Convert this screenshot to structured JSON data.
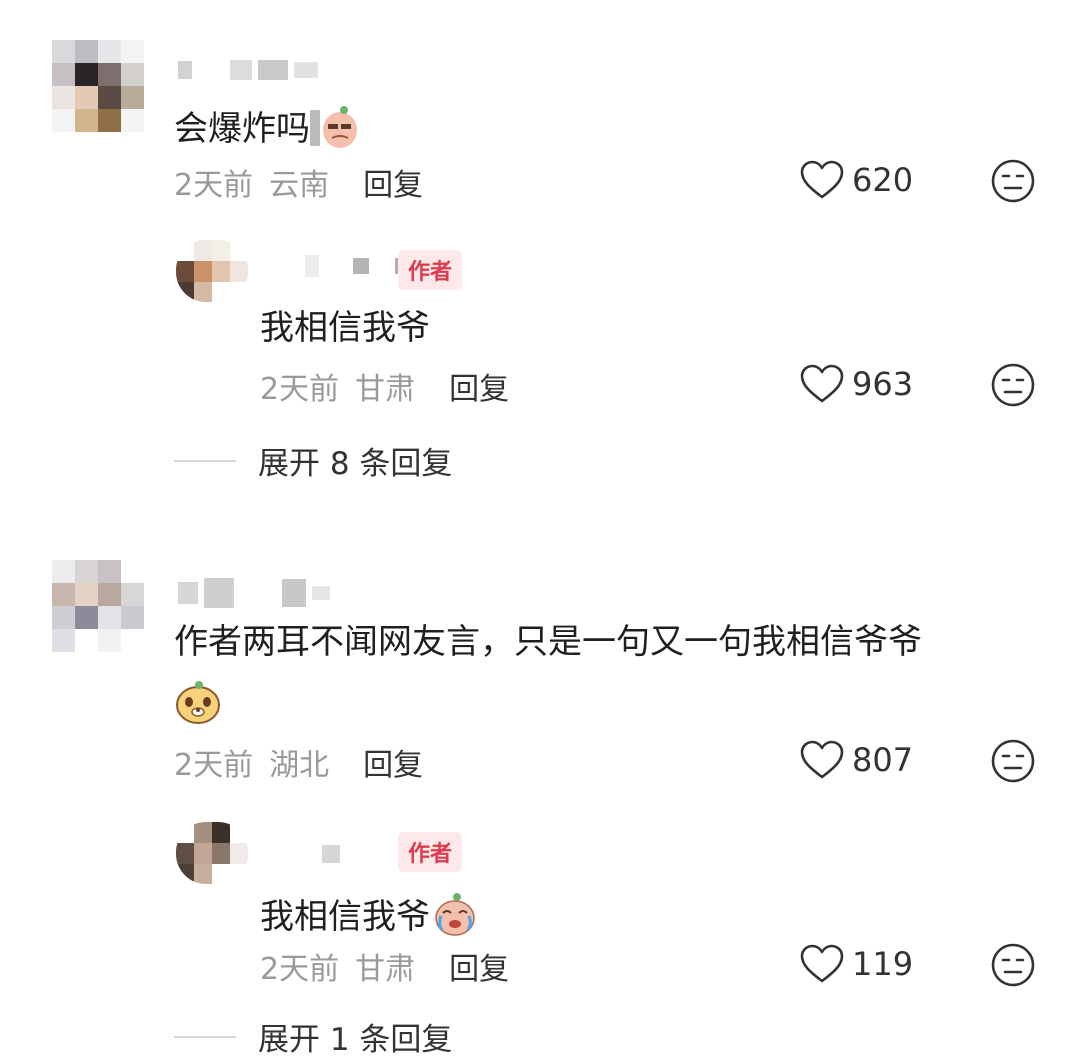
{
  "comments": [
    {
      "text": "会爆炸吗",
      "time": "2天前",
      "location": "云南",
      "reply_label": "回复",
      "likes": "620",
      "replies": [
        {
          "badge": "作者",
          "text": "我相信我爷",
          "time": "2天前",
          "location": "甘肃",
          "reply_label": "回复",
          "likes": "963"
        }
      ],
      "expand_label": "展开 8 条回复"
    },
    {
      "text_line1": "作者两耳不闻网友言，只是一句又一句我相信爷爷",
      "time": "2天前",
      "location": "湖北",
      "reply_label": "回复",
      "likes": "807",
      "replies": [
        {
          "badge": "作者",
          "text": "我相信我爷",
          "time": "2天前",
          "location": "甘肃",
          "reply_label": "回复",
          "likes": "119"
        }
      ],
      "expand_label": "展开 1 条回复"
    }
  ],
  "icons": {
    "like": "heart-outline-icon",
    "dislike": "neutral-face-icon",
    "sticker": "bean-sticker-icon"
  },
  "colors": {
    "badge_text": "#e03a4e",
    "badge_bg": "#fde8ea",
    "meta_text": "#9a9a9a"
  }
}
